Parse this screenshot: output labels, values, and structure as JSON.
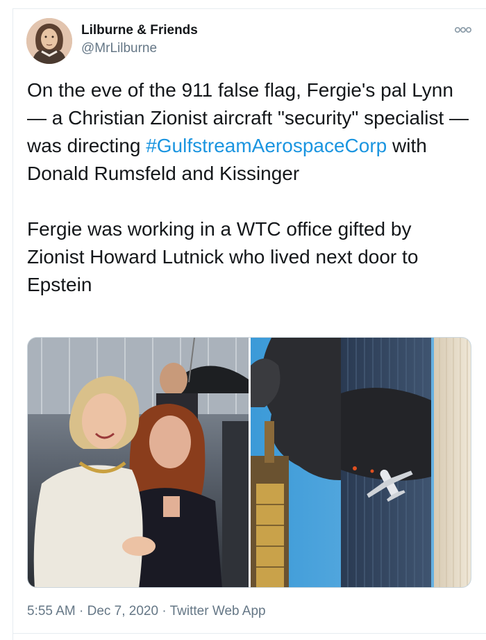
{
  "tweet": {
    "author": {
      "display_name": "Lilburne & Friends",
      "handle": "@MrLilburne",
      "avatar_icon": "portrait-avatar"
    },
    "more_icon": "more-dots-icon",
    "text_before_hashtag": "On the eve of the 911 false flag, Fergie's pal Lynn — a Christian Zionist aircraft \"security\" specialist — was directing ",
    "hashtag": "#GulfstreamAerospaceCorp",
    "text_after_hashtag": " with Donald Rumsfeld and Kissinger\n\nFergie was working in a WTC office gifted by Zionist Howard Lutnick who lived next door to Epstein",
    "timestamp_time": "5:55 AM",
    "separator": "·",
    "timestamp_date": "Dec 7, 2020",
    "source": "Twitter Web App"
  },
  "colors": {
    "text": "#14171a",
    "secondary": "#657786",
    "link": "#1b95e0",
    "border": "#e6ecf0"
  }
}
